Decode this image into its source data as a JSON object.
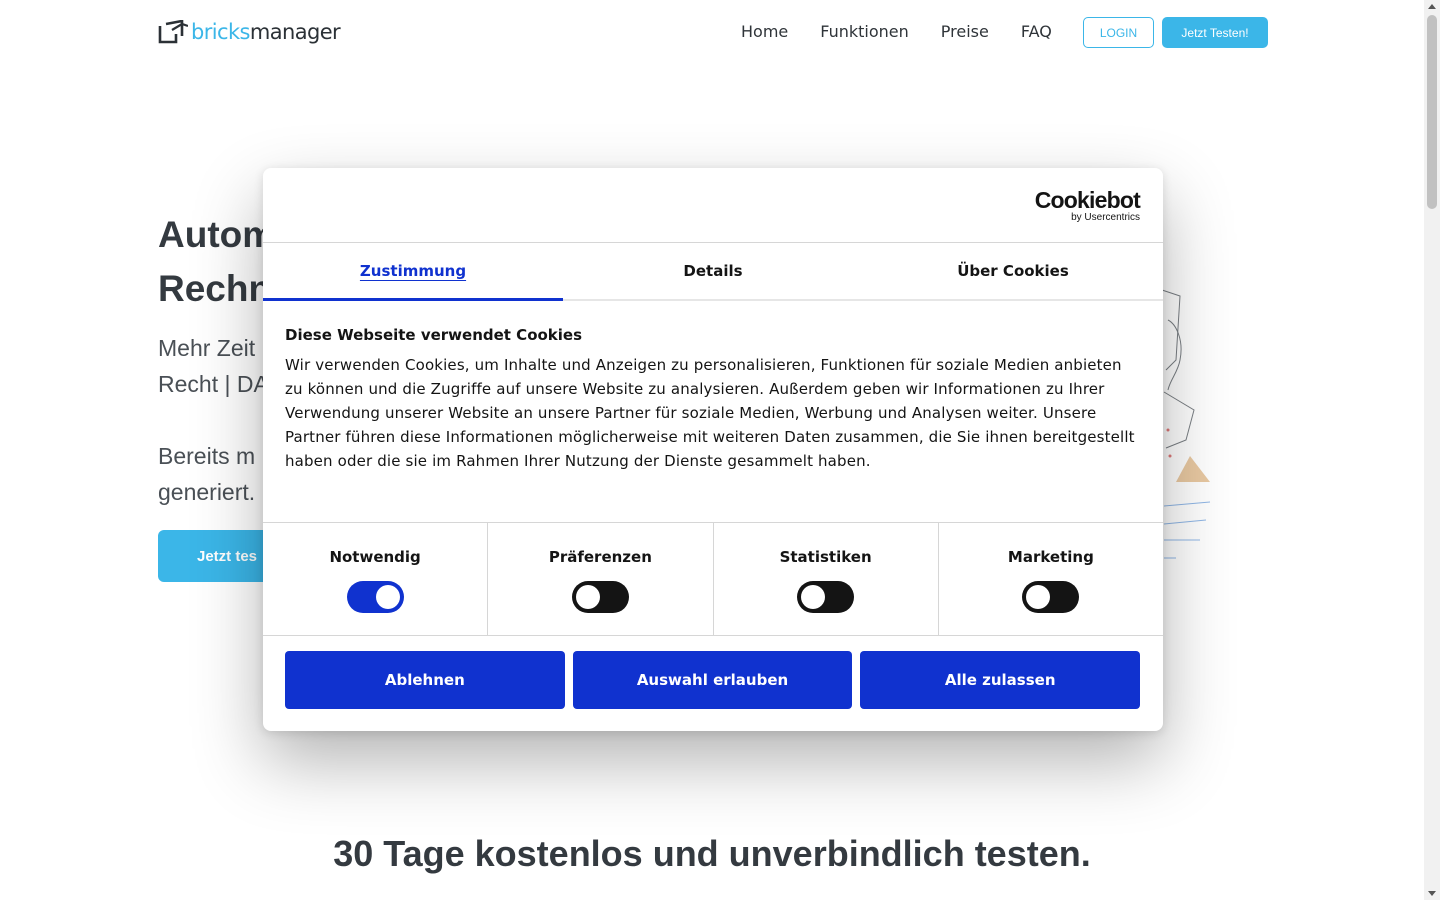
{
  "header": {
    "logo": {
      "part1": "bricks",
      "part2": "manager"
    },
    "nav": [
      "Home",
      "Funktionen",
      "Preise",
      "FAQ"
    ],
    "login_label": "LOGIN",
    "test_label": "Jetzt Testen!"
  },
  "hero": {
    "title_line1": "Autom",
    "title_line2": "Rechn",
    "sub_line1": "Mehr Zeit",
    "sub_line2": "Recht | DA",
    "sub2_line1": "Bereits m",
    "sub2_line2": "generiert.",
    "cta_label": "Jetzt tes"
  },
  "bottom_title": "30 Tage kostenlos und unverbindlich testen.",
  "cookie_dialog": {
    "brand": {
      "name": "Cookiebot",
      "byline": "by Usercentrics"
    },
    "tabs": [
      {
        "label": "Zustimmung",
        "active": true
      },
      {
        "label": "Details",
        "active": false
      },
      {
        "label": "Über Cookies",
        "active": false
      }
    ],
    "heading": "Diese Webseite verwendet Cookies",
    "text": "Wir verwenden Cookies, um Inhalte und Anzeigen zu personalisieren, Funktionen für soziale Medien anbieten zu können und die Zugriffe auf unsere Website zu analysieren. Außerdem geben wir Informationen zu Ihrer Verwendung unserer Website an unsere Partner für soziale Medien, Werbung und Analysen weiter. Unsere Partner führen diese Informationen möglicherweise mit weiteren Daten zusammen, die Sie ihnen bereitgestellt haben oder die sie im Rahmen Ihrer Nutzung der Dienste gesammelt haben.",
    "toggles": [
      {
        "label": "Notwendig",
        "on": true
      },
      {
        "label": "Präferenzen",
        "on": false
      },
      {
        "label": "Statistiken",
        "on": false
      },
      {
        "label": "Marketing",
        "on": false
      }
    ],
    "buttons": {
      "decline": "Ablehnen",
      "allow_selection": "Auswahl erlauben",
      "allow_all": "Alle zulassen"
    }
  },
  "colors": {
    "brand_blue": "#3bb6e8",
    "cookiebot_blue": "#1032cf",
    "text_dark": "#343a40"
  }
}
